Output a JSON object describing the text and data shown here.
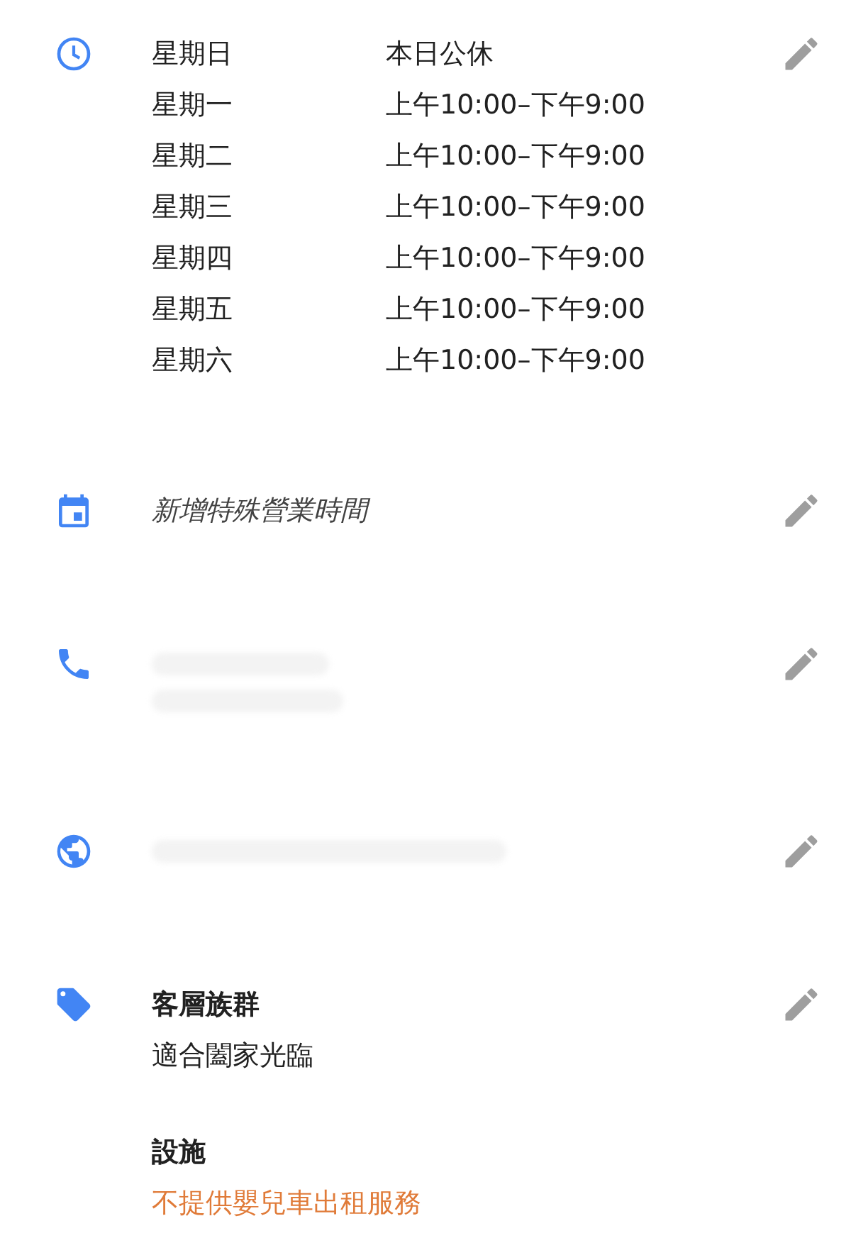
{
  "sections": [
    {
      "kind": "hours",
      "rows": [
        {
          "day": "星期日",
          "hours": "本日公休"
        },
        {
          "day": "星期一",
          "hours": "上午10:00–下午9:00"
        },
        {
          "day": "星期二",
          "hours": "上午10:00–下午9:00"
        },
        {
          "day": "星期三",
          "hours": "上午10:00–下午9:00"
        },
        {
          "day": "星期四",
          "hours": "上午10:00–下午9:00"
        },
        {
          "day": "星期五",
          "hours": "上午10:00–下午9:00"
        },
        {
          "day": "星期六",
          "hours": "上午10:00–下午9:00"
        }
      ]
    },
    {
      "kind": "special_hours",
      "label": "新增特殊營業時間"
    },
    {
      "kind": "phone"
    },
    {
      "kind": "website"
    },
    {
      "kind": "attributes",
      "groups": [
        {
          "title": "客層族群",
          "values": [
            {
              "text": "適合闔家光臨",
              "negative": false
            }
          ]
        },
        {
          "title": "設施",
          "values": [
            {
              "text": "不提供嬰兒車出租服務",
              "negative": true
            }
          ]
        }
      ]
    }
  ]
}
